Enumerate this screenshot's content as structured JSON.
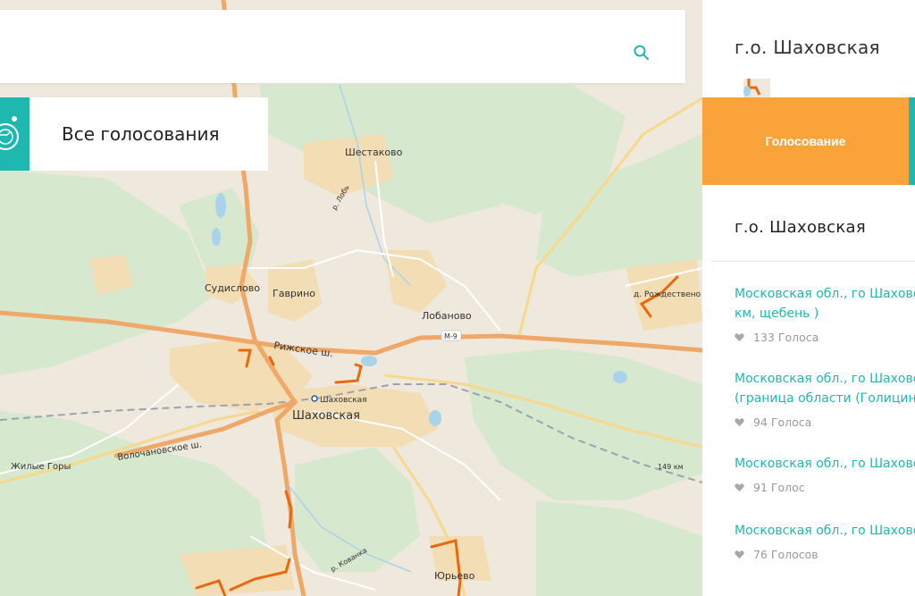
{
  "search": {
    "placeholder": "",
    "value": "",
    "icon": "search-icon"
  },
  "all_votes": {
    "label": "Все голосования",
    "icon": "logo-icon"
  },
  "panel": {
    "title": "г.о. Шаховская",
    "tab_vote": "Голосование",
    "subtitle": "г.о. Шаховская",
    "items": [
      {
        "title_line1": "Московская обл., го Шаховская",
        "title_line2": "км, щебень )",
        "votes": "133 Голоса"
      },
      {
        "title_line1": "Московская обл., го Шаховская",
        "title_line2": "(граница области (Голицино",
        "votes": "94 Голоса"
      },
      {
        "title_line1": "Московская обл., го Шаховская",
        "title_line2": "",
        "votes": "91 Голос"
      },
      {
        "title_line1": "Московская обл., го Шаховская",
        "title_line2": "",
        "votes": "76 Голосов"
      }
    ]
  },
  "map": {
    "labels": {
      "shestakovo": "Шестаково",
      "lob": "р. Лобь",
      "sudislovo": "Судислово",
      "gavrino": "Гаврино",
      "lobanovo": "Лобаново",
      "rozhdestveno": "д. Рождествено",
      "rizhskoe": "Рижское ш.",
      "m9": "М-9",
      "station": "Шаховская",
      "town": "Шаховская",
      "volochanovskoe": "Волочановское ш.",
      "zhilye_gory": "Жилые Горы",
      "km149": "149 км",
      "kovanka": "р. Кованка",
      "yurievo": "Юрьево"
    }
  },
  "colors": {
    "accent": "#1fb8b0",
    "tab_orange": "#fba33b",
    "road": "#f0a868",
    "route": "#e8680f"
  }
}
